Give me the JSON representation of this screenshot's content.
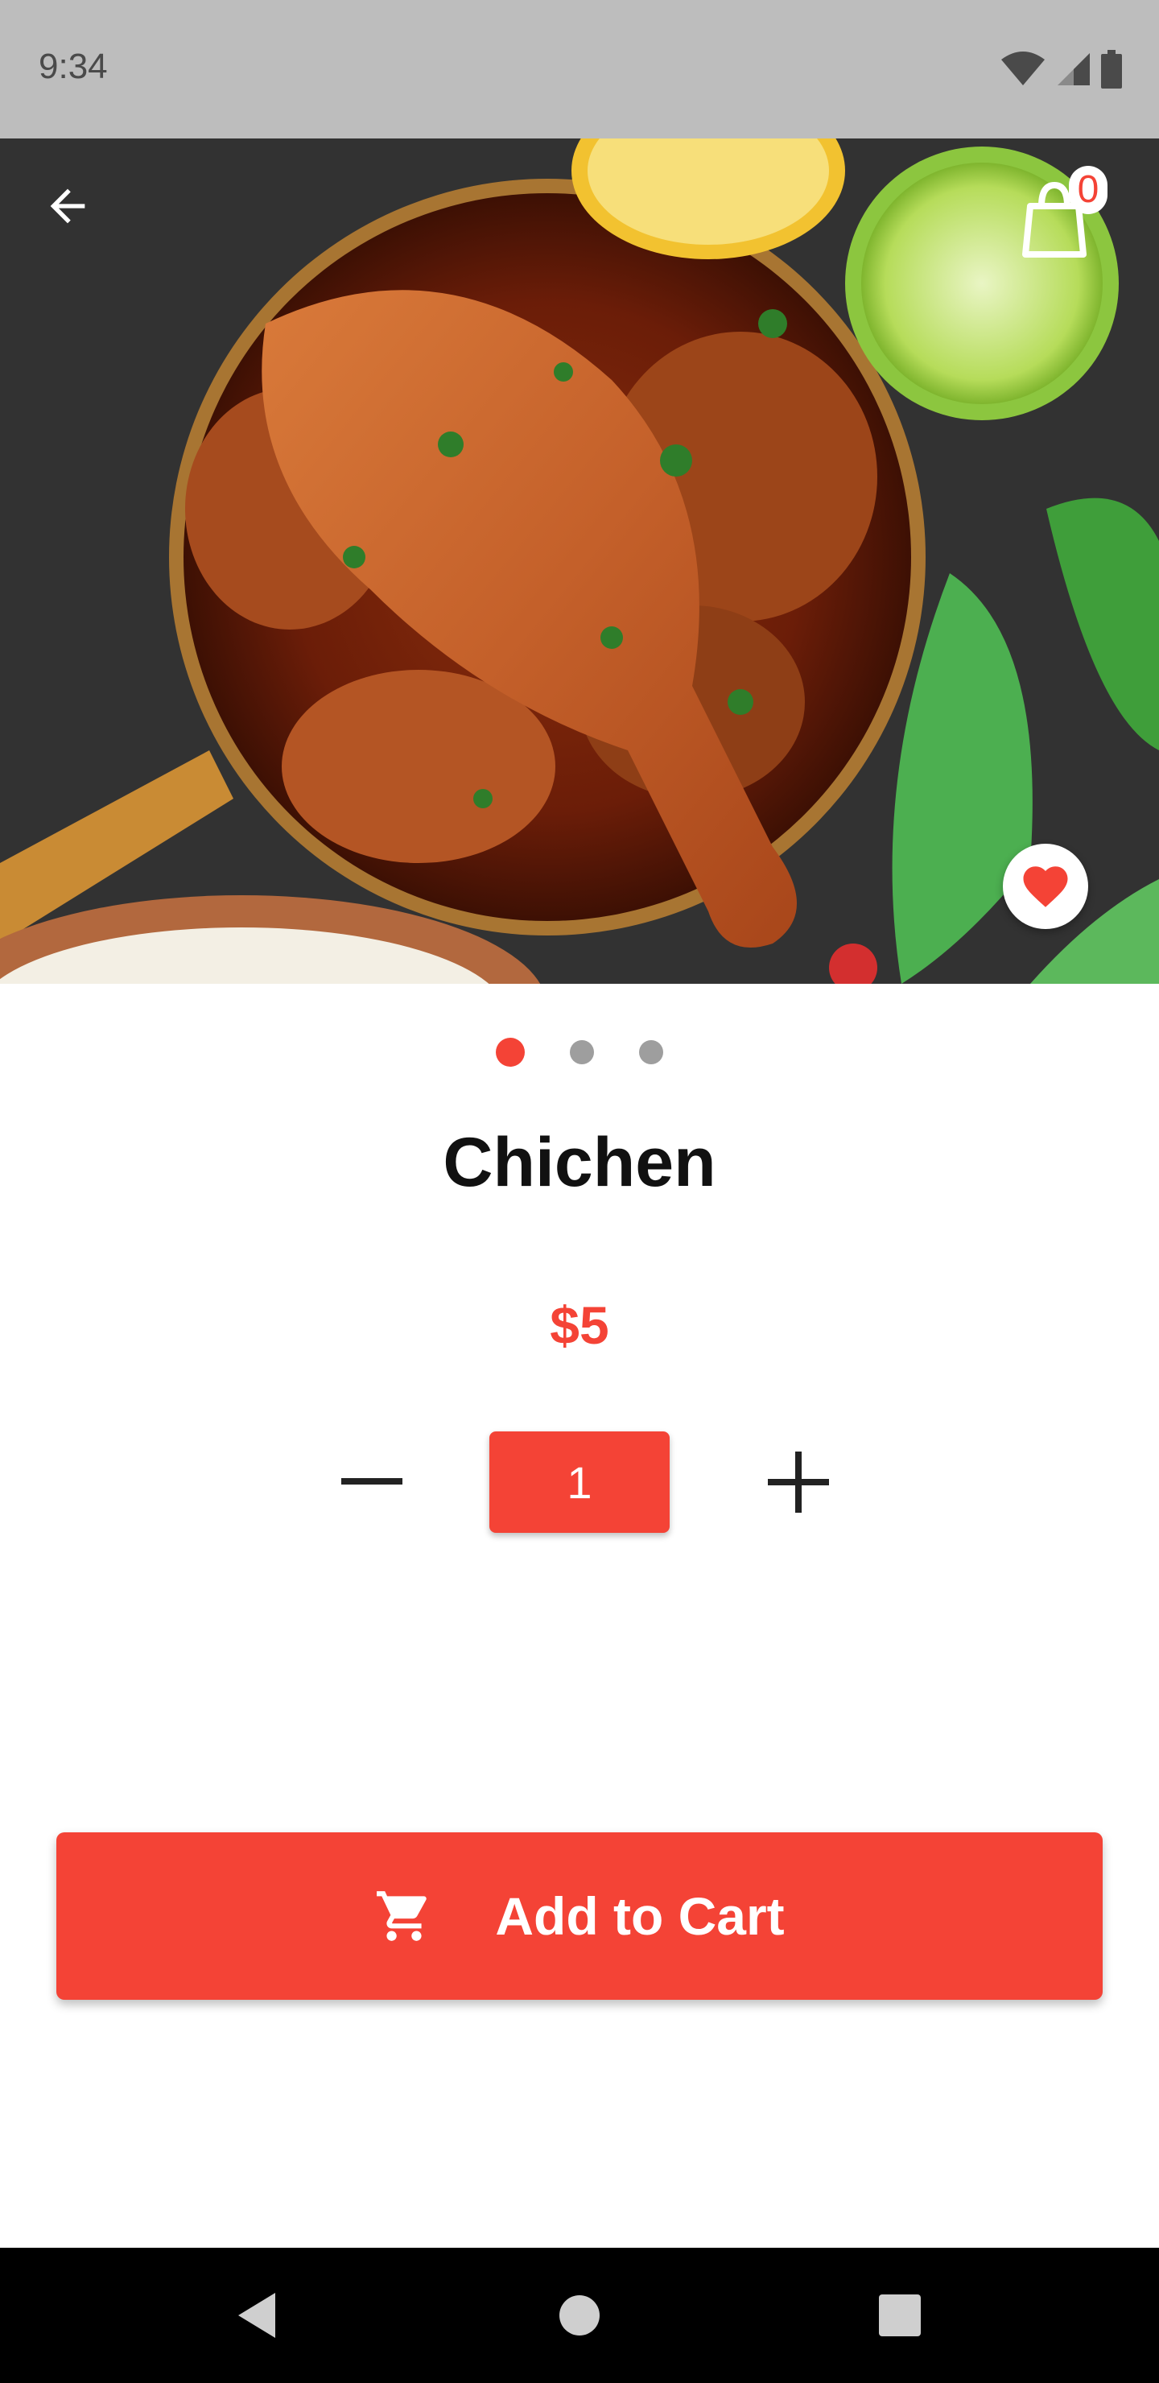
{
  "status_bar": {
    "time": "9:34"
  },
  "header": {
    "cart_count": "0"
  },
  "product": {
    "name": "Chichen",
    "price": "$5",
    "quantity": "1",
    "favorited": true
  },
  "carousel": {
    "total": 3,
    "active_index": 0
  },
  "actions": {
    "add_to_cart_label": "Add to Cart"
  },
  "icons": {
    "back": "arrow-back-icon",
    "cart_bag": "shopping-bag-icon",
    "favorite": "heart-icon",
    "minus": "minus-icon",
    "plus": "plus-icon",
    "cart": "shopping-cart-icon"
  },
  "colors": {
    "accent": "#f44336",
    "status_bar": "#bdbdbd",
    "nav_bar": "#000000"
  }
}
